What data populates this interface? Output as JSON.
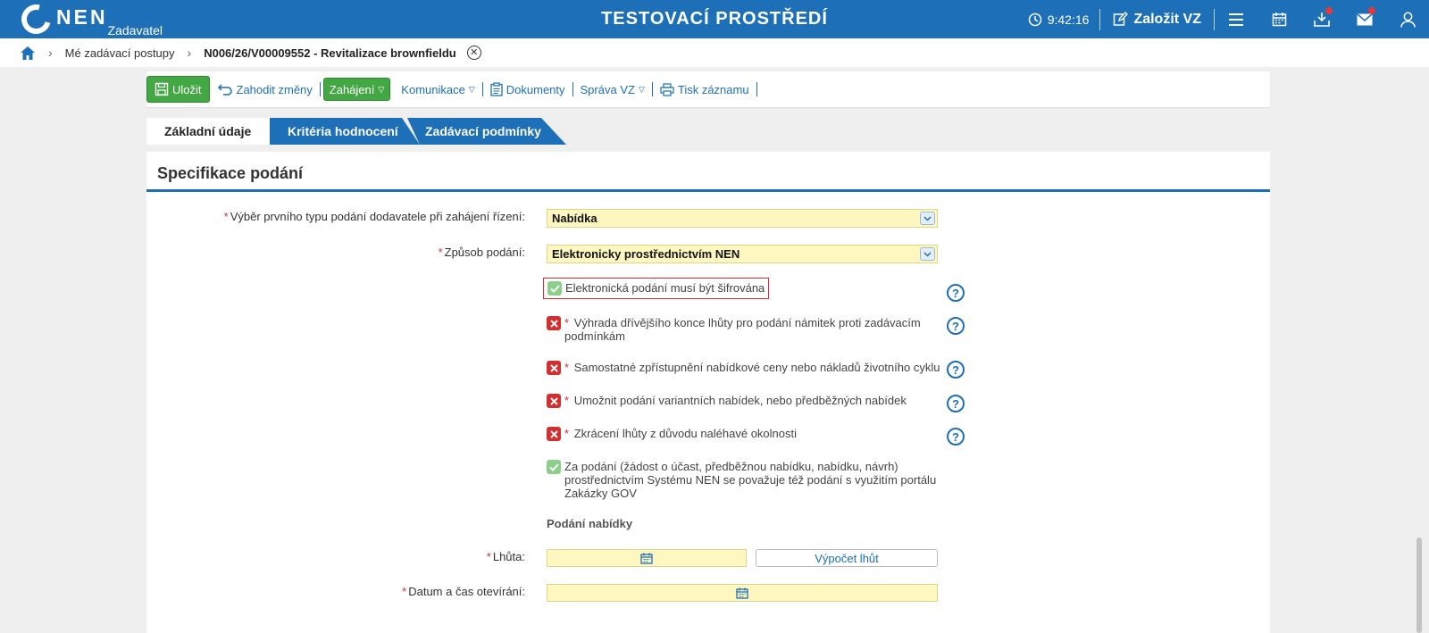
{
  "header": {
    "logo_text": "NEN",
    "logo_sub": "Zadavatel",
    "env_title": "TESTOVACÍ PROSTŘEDÍ",
    "clock": "9:42:16",
    "create_label": "Založit VZ",
    "icons": [
      "clock-icon",
      "edit-icon",
      "menu-icon",
      "calendar-icon",
      "download-icon",
      "mail-icon",
      "user-icon"
    ]
  },
  "breadcrumb": {
    "items": [
      "Mé zadávací postupy",
      "N006/26/V00009552 - Revitalizace brownfieldu"
    ]
  },
  "toolbar": {
    "save": "Uložit",
    "discard": "Zahodit změny",
    "start": "Zahájení",
    "communication": "Komunikace",
    "documents": "Dokumenty",
    "management": "Správa VZ",
    "print": "Tisk záznamu"
  },
  "tabs": [
    "Základní údaje",
    "Kritéria hodnocení",
    "Zadávací podmínky"
  ],
  "panel": {
    "title": "Specifikace podání",
    "fields": {
      "first_type_label": "Výběr prvního typu podání dodavatele při zahájení řízení:",
      "first_type_value": "Nabídka",
      "method_label": "Způsob podání:",
      "method_value": "Elektronicky prostřednictvím NEN"
    },
    "checkboxes": [
      {
        "label": "Elektronická podání musí být šifrována",
        "checked": true,
        "required": false
      },
      {
        "label": "Výhrada dřívějšího konce lhůty pro podání námitek proti zadávacím podmínkám",
        "checked": false,
        "required": true
      },
      {
        "label": "Samostatné zpřístupnění nabídkové ceny nebo nákladů životního cyklu",
        "checked": false,
        "required": true
      },
      {
        "label": "Umožnit podání variantních nabídek, nebo předběžných nabídek",
        "checked": false,
        "required": true
      },
      {
        "label": "Zkrácení lhůty z důvodu naléhavé okolnosti",
        "checked": false,
        "required": true
      },
      {
        "label": "Za podání (žádost o účast, předběžnou nabídku, nabídku, návrh) prostřednictvím Systému NEN se považuje též podání s využitím portálu Zakázky GOV",
        "checked": true,
        "required": false
      }
    ],
    "offer_section": "Podání nabídky",
    "deadline_label": "Lhůta:",
    "calc_button": "Výpočet lhůt",
    "opening_label": "Datum a čas otevírání:",
    "required_mark": "*",
    "help_mark": "?"
  },
  "colors": {
    "primary": "#1d6fb8",
    "green": "#43a844",
    "required": "#d32f2f",
    "input_bg": "#fff7c0"
  }
}
